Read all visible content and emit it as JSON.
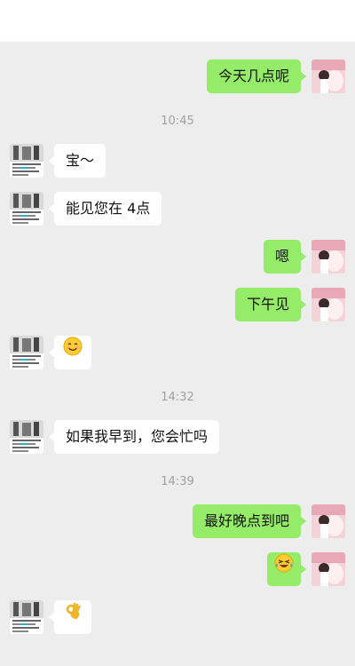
{
  "timestamps": [
    "10:45",
    "14:32",
    "14:39"
  ],
  "messages": {
    "m1": {
      "text": "今天几点呢"
    },
    "m2": {
      "text": "宝～"
    },
    "m3": {
      "text": "能见您在 4点"
    },
    "m4": {
      "text": "嗯"
    },
    "m5": {
      "text": "下午见"
    },
    "m6": {
      "icon": "smile-emoji-icon"
    },
    "m7": {
      "text": "如果我早到，您会忙吗"
    },
    "m8": {
      "text": "最好晚点到吧"
    },
    "m9": {
      "icon": "laughing-tears-emoji-icon"
    },
    "m10": {
      "icon": "ok-hand-emoji-icon"
    }
  },
  "colors": {
    "background": "#ededed",
    "my_bubble": "#95ec69",
    "their_bubble": "#ffffff",
    "timestamp": "#a0a0a0"
  }
}
